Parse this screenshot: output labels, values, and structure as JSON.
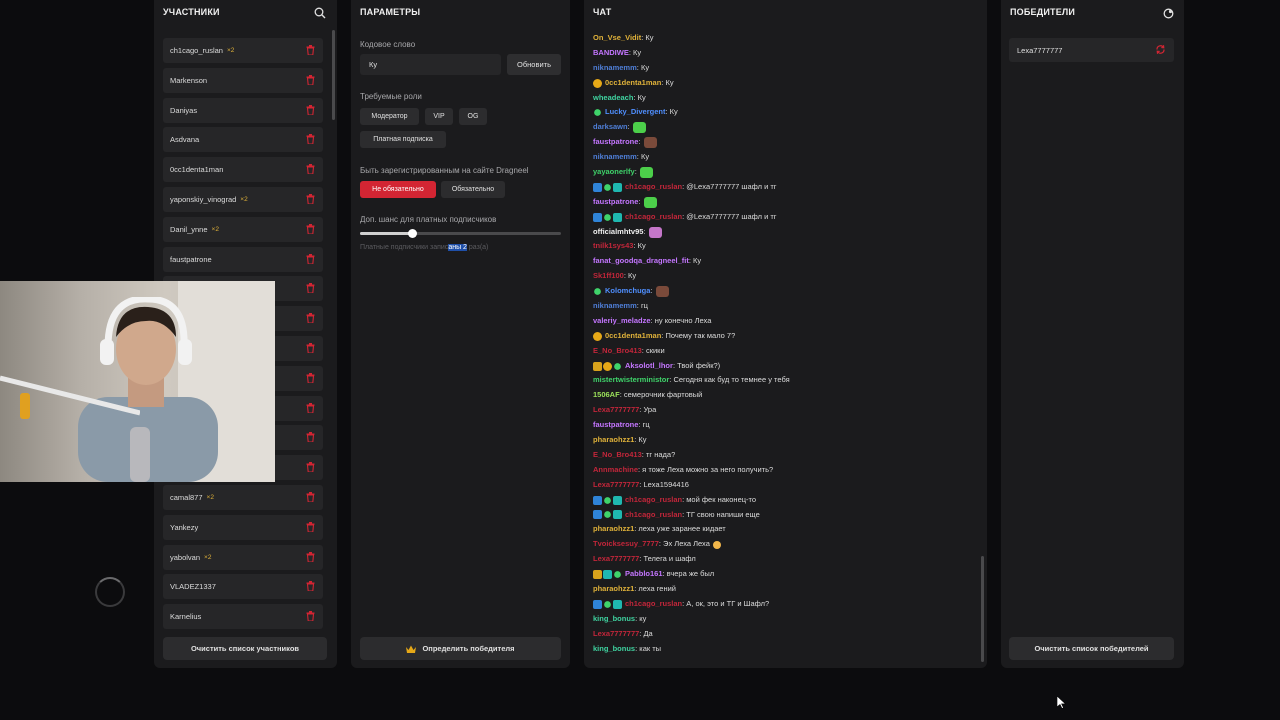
{
  "participants": {
    "title": "УЧАСТНИКИ",
    "items": [
      {
        "name": "ch1cago_ruslan",
        "mult": "×2"
      },
      {
        "name": "Markenson",
        "mult": ""
      },
      {
        "name": "Daniyas",
        "mult": ""
      },
      {
        "name": "Asdvana",
        "mult": ""
      },
      {
        "name": "0cc1denta1man",
        "mult": ""
      },
      {
        "name": "yaponskiy_vinograd",
        "mult": "×2"
      },
      {
        "name": "Danil_ynne",
        "mult": "×2"
      },
      {
        "name": "faustpatrone",
        "mult": ""
      },
      {
        "name": "",
        "mult": ""
      },
      {
        "name": "",
        "mult": ""
      },
      {
        "name": "",
        "mult": ""
      },
      {
        "name": "",
        "mult": ""
      },
      {
        "name": "",
        "mult": ""
      },
      {
        "name": "",
        "mult": ""
      },
      {
        "name": "",
        "mult": ""
      },
      {
        "name": "camal877",
        "mult": "×2"
      },
      {
        "name": "Yankezy",
        "mult": ""
      },
      {
        "name": "yabolvan",
        "mult": "×2"
      },
      {
        "name": "VLADEZ1337",
        "mult": ""
      },
      {
        "name": "Karnelius",
        "mult": ""
      }
    ],
    "clear_button": "Очистить список участников"
  },
  "params": {
    "title": "ПАРАМЕТРЫ",
    "keyword_label": "Кодовое слово",
    "keyword_value": "Ку",
    "refresh_button": "Обновить",
    "roles_label": "Требуемые роли",
    "roles": [
      "Модератор",
      "VIP",
      "OG",
      "Платная подписка"
    ],
    "registered_label": "Быть зарегистрированным на сайте Dragneel",
    "registered_options": [
      "Не обязательно",
      "Обязательно"
    ],
    "registered_selected": "Не обязательно",
    "chance_label": "Доп. шанс для платных подписчиков",
    "chance_value": 0.26,
    "chance_hint_pre": "Платные подписчики запис",
    "chance_hint_highlight": "аны 2",
    "chance_hint_post": " раз(а)",
    "pick_winner_button": "Определить победителя"
  },
  "chat": {
    "title": "ЧАТ",
    "messages": [
      {
        "badges": [],
        "user": "On_Vse_Vidit",
        "color": "#e0b23a",
        "text": ": Ку",
        "emote": ""
      },
      {
        "badges": [],
        "user": "BANDIWE",
        "color": "#c476ff",
        "text": ": Ку",
        "emote": ""
      },
      {
        "badges": [],
        "user": "niknamemm",
        "color": "#4f7fd8",
        "text": ": Ку",
        "emote": ""
      },
      {
        "badges": [
          "gold"
        ],
        "user": "0cc1denta1man",
        "color": "#e0b23a",
        "text": ": Ку",
        "emote": ""
      },
      {
        "badges": [],
        "user": "wheadeach",
        "color": "#3fd3a0",
        "text": ": Ку",
        "emote": ""
      },
      {
        "badges": [
          "green"
        ],
        "user": "Lucky_Divergent",
        "color": "#4f8fff",
        "text": ": Ку",
        "emote": ""
      },
      {
        "badges": [],
        "user": "darksawn",
        "color": "#4f7fd8",
        "text": ":",
        "emote": "green"
      },
      {
        "badges": [],
        "user": "faustpatrone",
        "color": "#c476ff",
        "text": ":",
        "emote": "face"
      },
      {
        "badges": [],
        "user": "niknamemm",
        "color": "#4f7fd8",
        "text": ": Ку",
        "emote": ""
      },
      {
        "badges": [],
        "user": "yayaonerlfy",
        "color": "#3fd36a",
        "text": ":",
        "emote": "green"
      },
      {
        "badges": [
          "blue",
          "green",
          "teal"
        ],
        "user": "ch1cago_ruslan",
        "color": "#c2263a",
        "text": ": @Lexa7777777 шафл и тг",
        "emote": ""
      },
      {
        "badges": [],
        "user": "faustpatrone",
        "color": "#c476ff",
        "text": ":",
        "emote": "green"
      },
      {
        "badges": [
          "blue",
          "green",
          "teal"
        ],
        "user": "ch1cago_ruslan",
        "color": "#c2263a",
        "text": ": @Lexa7777777 шафл и тг",
        "emote": ""
      },
      {
        "badges": [],
        "user": "officialmhtv95",
        "color": "#f0f0f0",
        "text": ":",
        "emote": "pink"
      },
      {
        "badges": [],
        "user": "tnilk1sys43",
        "color": "#c2263a",
        "text": ": Ку",
        "emote": ""
      },
      {
        "badges": [],
        "user": "fanat_goodqa_dragneel_fit",
        "color": "#c476ff",
        "text": ": Ку",
        "emote": ""
      },
      {
        "badges": [],
        "user": "Sk1ff100",
        "color": "#c2263a",
        "text": ": Ку",
        "emote": ""
      },
      {
        "badges": [
          "green"
        ],
        "user": "Kolomchuga",
        "color": "#4f8fff",
        "text": ":",
        "emote": "face"
      },
      {
        "badges": [],
        "user": "niknamemm",
        "color": "#4f7fd8",
        "text": ": гц",
        "emote": ""
      },
      {
        "badges": [],
        "user": "valeriy_meladze",
        "color": "#c476ff",
        "text": ": ну конечно Леха",
        "emote": ""
      },
      {
        "badges": [
          "gold"
        ],
        "user": "0cc1denta1man",
        "color": "#e0b23a",
        "text": ": Почему так мало 7?",
        "emote": ""
      },
      {
        "badges": [],
        "user": "E_No_Bro413",
        "color": "#c2263a",
        "text": ": скики",
        "emote": ""
      },
      {
        "badges": [
          "crown",
          "gold",
          "green"
        ],
        "user": "Aksolotl_lhor",
        "color": "#c476ff",
        "text": ": Твой фейк?)",
        "emote": ""
      },
      {
        "badges": [],
        "user": "mistertwisterministor",
        "color": "#3fd36a",
        "text": ": Сегодня как буд то темнее у тебя",
        "emote": ""
      },
      {
        "badges": [],
        "user": "1506AF",
        "color": "#9be05a",
        "text": ": семерочник фартовый",
        "emote": ""
      },
      {
        "badges": [],
        "user": "Lexa7777777",
        "color": "#c2263a",
        "text": ": Ура",
        "emote": ""
      },
      {
        "badges": [],
        "user": "faustpatrone",
        "color": "#c476ff",
        "text": ": гц",
        "emote": ""
      },
      {
        "badges": [],
        "user": "pharaohzz1",
        "color": "#e0b23a",
        "text": ": Ку",
        "emote": ""
      },
      {
        "badges": [],
        "user": "E_No_Bro413",
        "color": "#c2263a",
        "text": ": тг нада?",
        "emote": ""
      },
      {
        "badges": [],
        "user": "Annmachine",
        "color": "#c2263a",
        "text": ": я тоже Леха можно за него получить?",
        "emote": ""
      },
      {
        "badges": [],
        "user": "Lexa7777777",
        "color": "#c2263a",
        "text": ": Lexa1594416",
        "emote": ""
      },
      {
        "badges": [
          "blue",
          "green",
          "teal"
        ],
        "user": "ch1cago_ruslan",
        "color": "#c2263a",
        "text": ": мой фек наконец-то",
        "emote": ""
      },
      {
        "badges": [
          "blue",
          "green",
          "teal"
        ],
        "user": "ch1cago_ruslan",
        "color": "#c2263a",
        "text": ": ТГ свою напиши еще",
        "emote": ""
      },
      {
        "badges": [],
        "user": "pharaohzz1",
        "color": "#e0b23a",
        "text": ": леха уже заранее кидает",
        "emote": ""
      },
      {
        "badges": [],
        "user": "Tvoicksesuy_7777",
        "color": "#c2263a",
        "text": ": Эх Леха Леха",
        "emote": "emoji"
      },
      {
        "badges": [],
        "user": "Lexa7777777",
        "color": "#c2263a",
        "text": ": Телега и шафл",
        "emote": ""
      },
      {
        "badges": [
          "crown",
          "teal",
          "green"
        ],
        "user": "Pabblo161",
        "color": "#c476ff",
        "text": ": вчера же был",
        "emote": ""
      },
      {
        "badges": [],
        "user": "pharaohzz1",
        "color": "#e0b23a",
        "text": ": леха гений",
        "emote": ""
      },
      {
        "badges": [
          "blue",
          "green",
          "teal"
        ],
        "user": "ch1cago_ruslan",
        "color": "#c2263a",
        "text": ": А, ок, это и ТГ и Шафл?",
        "emote": ""
      },
      {
        "badges": [],
        "user": "king_bonus",
        "color": "#3fd3a0",
        "text": ": ку",
        "emote": ""
      },
      {
        "badges": [],
        "user": "Lexa7777777",
        "color": "#c2263a",
        "text": ": Да",
        "emote": ""
      },
      {
        "badges": [],
        "user": "king_bonus",
        "color": "#3fd3a0",
        "text": ": как ты",
        "emote": ""
      }
    ]
  },
  "winners": {
    "title": "ПОБЕДИТЕЛИ",
    "items": [
      "Lexa7777777"
    ],
    "clear_button": "Очистить список победителей"
  },
  "colors": {
    "accent_red": "#d32533",
    "panel": "#1b1b1d",
    "item": "#262628",
    "gold": "#e0b23a"
  },
  "icons": {
    "search": "search-icon",
    "trash": "trash-icon",
    "crown": "crown-icon",
    "refresh": "refresh-icon",
    "settings": "settings-icon"
  }
}
